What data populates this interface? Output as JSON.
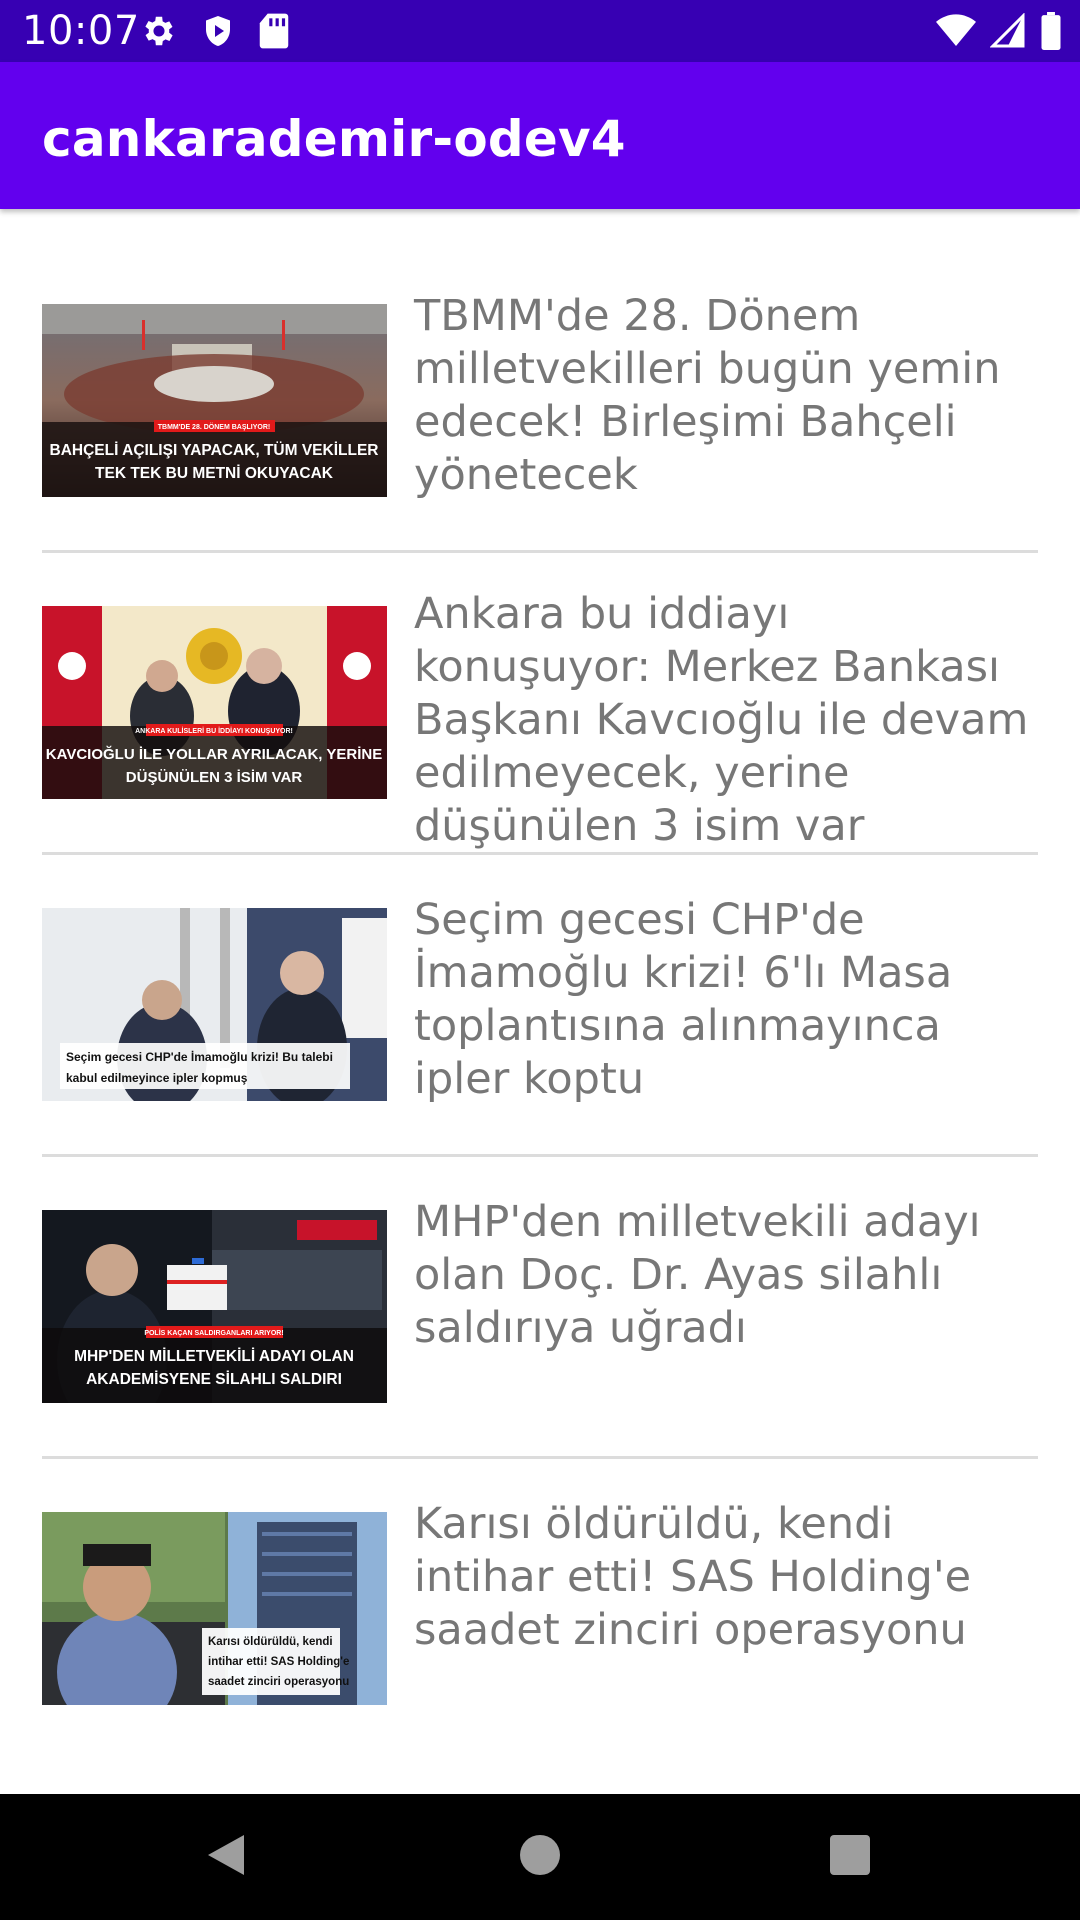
{
  "status_bar": {
    "time": "10:07",
    "left_icons": [
      "gear-icon",
      "shield-icon",
      "sd-card-icon"
    ],
    "right_icons": [
      "wifi-icon",
      "cellular-signal-icon",
      "battery-icon"
    ]
  },
  "app_bar": {
    "title": "cankarademir-odev4",
    "color": "#6200ee",
    "status_color": "#3700b3"
  },
  "news_items": [
    {
      "headline": "TBMM'de 28. Dönem milletvekilleri bugün yemin edecek! Birleşimi Bahçeli yönetecek",
      "thumb_tag": "TBMM'DE 28. DÖNEM BAŞLIYOR!",
      "thumb_caption_1": "BAHÇELİ AÇILIŞI YAPACAK, TÜM VEKİLLER",
      "thumb_caption_2": "TEK TEK BU METNİ OKUYACAK"
    },
    {
      "headline": "Ankara bu iddiayı konuşuyor: Merkez Bankası Başkanı Kavcıoğlu ile devam edilmeyecek, yerine düşünülen 3 isim var",
      "thumb_tag": "ANKARA KULİSLERİ BU İDDİAYI KONUŞUYOR!",
      "thumb_caption_1": "KAVCIOĞLU İLE YOLLAR AYRILACAK, YERİNE",
      "thumb_caption_2": "DÜŞÜNÜLEN 3 İSİM VAR"
    },
    {
      "headline": "Seçim gecesi CHP'de İmamoğlu krizi! 6'lı Masa toplantısına alınmayınca ipler koptu",
      "thumb_caption_1": "Seçim gecesi CHP'de İmamoğlu krizi! Bu talebi",
      "thumb_caption_2": "kabul edilmeyince ipler kopmuş"
    },
    {
      "headline": "MHP'den milletvekili adayı olan Doç. Dr. Ayas silahlı saldırıya uğradı",
      "thumb_tag": "POLİS KAÇAN SALDIRGANLARI ARIYOR!",
      "thumb_caption_1": "MHP'DEN MİLLETVEKİLİ ADAYI OLAN",
      "thumb_caption_2": "AKADEMİSYENE SİLAHLI SALDIRI"
    },
    {
      "headline": "Karısı öldürüldü, kendi intihar etti! SAS Holding'e saadet zinciri operasyonu",
      "thumb_caption_1": "Karısı öldürüldü, kendi",
      "thumb_caption_2": "intihar etti! SAS Holding'e",
      "thumb_caption_3": "saadet zinciri operasyonu"
    }
  ],
  "nav_bar": {
    "buttons": [
      "back-icon",
      "home-icon",
      "recents-icon"
    ]
  }
}
